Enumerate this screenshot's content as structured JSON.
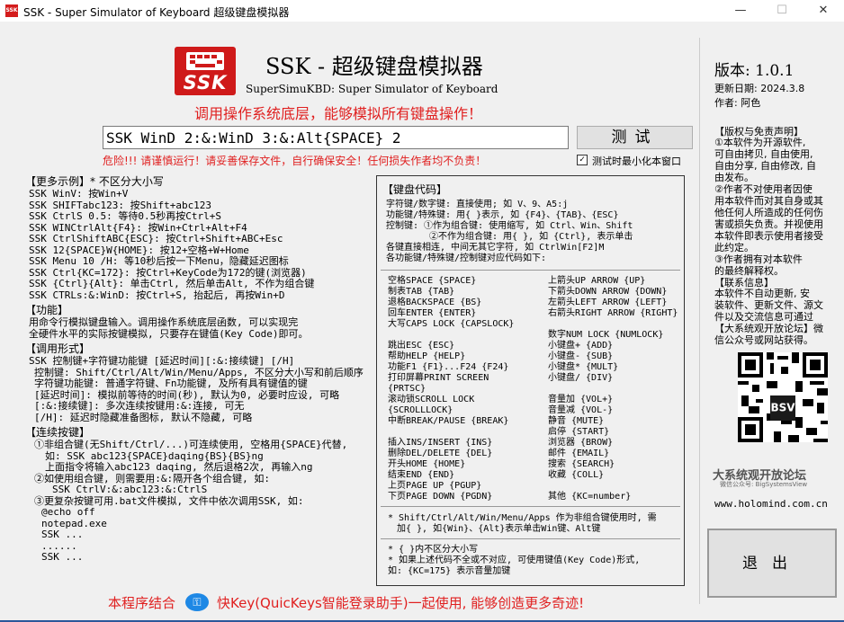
{
  "window": {
    "title": "SSK - Super Simulator of Keyboard 超级键盘模拟器",
    "minimize": "—",
    "maximize": "☐",
    "close": "✕"
  },
  "header": {
    "logo_text": "SSK",
    "title": "SSK - 超级键盘模拟器",
    "subtitle": "SuperSimuKBD: Super Simulator of Keyboard",
    "slogan": "调用操作系统底层，能够模拟所有键盘操作！"
  },
  "command": {
    "value": "SSK WinD 2:&:WinD 3:&:Alt{SPACE} 2",
    "test_button": "测试",
    "warning": "危险!!! 请谨慎运行！请妥善保存文件，自行确保安全！任何损失作者均不负责！",
    "minimize_on_test_checked": true,
    "minimize_on_test_label": "测试时最小化本窗口",
    "check_mark": "✓"
  },
  "left": {
    "examples_title": "【更多示例】* 不区分大小写",
    "examples": [
      "SSK WinV: 按Win+V",
      "SSK SHIFTabc123: 按Shift+abc123",
      "SSK CtrlS 0.5: 等待0.5秒再按Ctrl+S",
      "SSK WINCtrlAlt{F4}: 按Win+Ctrl+Alt+F4",
      "SSK CtrlShiftABC{ESC}: 按Ctrl+Shift+ABC+Esc",
      "SSK 12{SPACE}W{HOME}: 按12+空格+W+Home",
      "SSK Menu 10 /H: 等10秒后按一下Menu，隐藏延迟图标",
      "SSK Ctrl{KC=172}: 按Ctrl+KeyCode为172的键(浏览器)",
      "SSK {Ctrl}{Alt}: 单击Ctrl, 然后单击Alt, 不作为组合键",
      "SSK CTRLs:&:WinD: 按Ctrl+S, 抬起后, 再按Win+D"
    ],
    "function_title": "【功能】",
    "function_lines": [
      "用命令行模拟键盘输入。调用操作系统底层函数, 可以实现完",
      "全硬件水平的实际按键模拟, 只要存在键值(Key Code)即可。"
    ],
    "call_title": "【调用形式】",
    "call_lines": [
      "SSK 控制键+字符键功能键 [延迟时间][:&:接续键] [/H]",
      "控制键: Shift/Ctrl/Alt/Win/Menu/Apps, 不区分大小写和前后顺序",
      "字符键功能键: 普通字符键、Fn功能键, 及所有具有键值的键",
      "[延迟时间]: 模拟前等待的时间(秒), 默认为0, 必要时应设, 可略",
      "[:&:接续键]: 多次连续按键用:&:连接, 可无",
      "[/H]: 延迟时隐藏准备图标, 默认不隐藏, 可略"
    ],
    "combo_title": "【连续按键】",
    "combo_lines": [
      "①非组合键(无Shift/Ctrl/...)可连续使用, 空格用{SPACE}代替,",
      "如: SSK abc123{SPACE}daqing{BS}{BS}ng",
      "上面指令将输入abc123 daqing, 然后退格2次, 再输入ng",
      "②如使用组合键, 则需要用:&:隔开各个组合键, 如:",
      "SSK CtrlV:&:abc123:&:CtrlS",
      "③更复杂按键可用.bat文件模拟, 文件中依次调用SSK, 如:",
      "@echo off",
      "notepad.exe",
      "SSK ...",
      "......",
      "SSK ..."
    ]
  },
  "codes": {
    "title": "【键盘代码】",
    "intro": [
      "字符键/数字键: 直接使用; 如 V、9、A5:j",
      "功能键/特殊键: 用{ }表示, 如 {F4}、{TAB}、{ESC}",
      "控制键: ①作为组合键: 使用缩写, 如 Ctrl、Win、Shift",
      "②不作为组合键: 用{ }, 如 {Ctrl}, 表示单击",
      "各键直接相连, 中间无其它字符, 如 CtrlWin[F2]M",
      "各功能键/特殊键/控制键对应代码如下:"
    ],
    "col1": [
      "空格SPACE {SPACE}",
      "制表TAB {TAB}",
      "退格BACKSPACE {BS}",
      "回车ENTER {ENTER}",
      "大写CAPS LOCK {CAPSLOCK}",
      "",
      "跳出ESC {ESC}",
      "帮助HELP {HELP}",
      "功能F1 {F1}...F24 {F24}",
      "打印屏幕PRINT SCREEN",
      "{PRTSC}",
      "滚动锁SCROLL LOCK",
      "{SCROLLLOCK}",
      "中断BREAK/PAUSE {BREAK}",
      "",
      "插入INS/INSERT {INS}",
      "删除DEL/DELETE {DEL}",
      "开头HOME {HOME}",
      "结束END {END}",
      "上页PAGE UP {PGUP}",
      "下页PAGE DOWN {PGDN}"
    ],
    "col2": [
      "上箭头UP ARROW {UP}",
      "下箭头DOWN ARROW {DOWN}",
      "左箭头LEFT ARROW {LEFT}",
      "右箭头RIGHT ARROW {RIGHT}",
      "",
      "数字NUM LOCK {NUMLOCK}",
      "小键盘+ {ADD}",
      "小键盘- {SUB}",
      "小键盘* {MULT}",
      "小键盘/ {DIV}",
      "",
      "音量加 {VOL+}",
      "音量减 {VOL-}",
      "静音 {MUTE}",
      "启停 {START}",
      "浏览器 {BROW}",
      "邮件 {EMAIL}",
      "搜索 {SEARCH}",
      "收藏 {COLL}",
      "",
      "其他 {KC=number}"
    ],
    "note1": [
      "* Shift/Ctrl/Alt/Win/Menu/Apps 作为非组合键使用时, 需",
      "加{ }, 如{Win}、{Alt}表示单击Win键、Alt键"
    ],
    "note2": [
      "* { }内不区分大小写",
      "* 如果上述代码不全或不对应, 可使用键值(Key Code)形式,",
      "如: {KC=175} 表示音量加键"
    ]
  },
  "right": {
    "version": "版本: 1.0.1",
    "updated": "更新日期: 2024.3.8",
    "author": "作者: 阿色",
    "copyright_title": "【版权与免责声明】",
    "copyright_lines": [
      "①本软件为开源软件,",
      "可自由拷贝, 自由使用,",
      "自由分享, 自由修改, 自",
      "由发布。",
      "②作者不对使用者因使",
      "用本软件而对其自身或其",
      "他任何人所造成的任何伤",
      "害或损失负责。并视使用",
      "本软件即表示使用者接受",
      "此约定。",
      "③作者拥有对本软件",
      "的最终解释权。"
    ],
    "contact_title": "【联系信息】",
    "contact_lines": [
      "本软件不自动更新, 安",
      "装软件、更新文件、源文",
      "件以及交流信息可通过",
      "【大系统观开放论坛】微",
      "信公众号或网站获得。"
    ],
    "brand": "大系统观开放论坛",
    "brand_sub": "微信公众号: BigSystemsView",
    "website": "www.holomind.com.cn",
    "exit_button": "退出",
    "qr_badge": "BSV"
  },
  "footer": {
    "left": "本程序结合",
    "key_icon_symbol": "⚿",
    "right": "快Key(QuicKeys智能登录助手)一起使用, 能够创造更多奇迹!"
  }
}
